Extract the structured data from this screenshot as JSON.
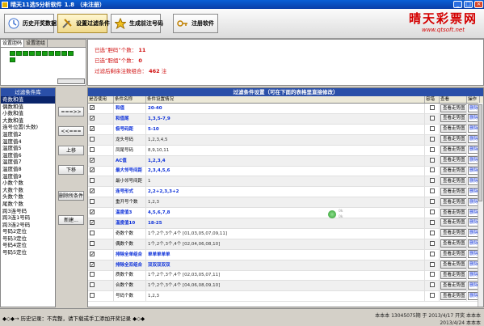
{
  "window": {
    "title": "晴天11选5分析软件",
    "version": "1.8",
    "reg_status": "（未注册）",
    "min": "_",
    "max": "□",
    "close": "×"
  },
  "toolbar": {
    "history_label": "历史开奖数据",
    "filter_label": "设置过滤条件",
    "generate_label": "生成前注号码",
    "register_label": "注册软件"
  },
  "brand": {
    "logo": "晴天彩票网",
    "url": "www.qtsoft.net"
  },
  "left_panel": {
    "tabs": [
      "设置胆码",
      "设置胆组"
    ]
  },
  "messages": {
    "line1_label": "已选“胆码”个数：",
    "line1_value": "11",
    "line2_label": "已选“胆组”个数：",
    "line2_value": "0",
    "line3_label": "过滤后剩余注数组合：",
    "line3_value": "462",
    "line3_unit": "注"
  },
  "condition_list": {
    "header": "过滤条件库",
    "items": [
      "奇数和值",
      "偶数和值",
      "小数和值",
      "大数和值",
      "连号位置(头数)",
      "温度值2",
      "温度值4",
      "温度值5",
      "温度值6",
      "温度值7",
      "温度值8",
      "温度值9",
      "小数个数",
      "大数个数",
      "头数个数",
      "尾数个数",
      "跨3连号码",
      "跨3连1号码",
      "跨3连2号码",
      "号码2定位",
      "号码3定位",
      "号码4定位",
      "号码5定位"
    ]
  },
  "middle_buttons": {
    "add_all": "===>>",
    "remove": "<<===",
    "move_up": "上移",
    "move_down": "下移",
    "delete_cond": "删除所条件",
    "new": "新建..."
  },
  "table": {
    "title": "过滤条件设置（可在下面的表格里直接修改）",
    "columns": [
      "是否使用",
      "条件名称",
      "条件设置情况",
      "容错",
      "查看",
      "操作"
    ],
    "chart_label": "查看走势图",
    "delete_label": "删除",
    "rows": [
      {
        "used": true,
        "name": "和值",
        "value": "20-40",
        "bold": true
      },
      {
        "used": true,
        "name": "和值尾",
        "value": "1,3,5-7,9",
        "bold": true
      },
      {
        "used": true,
        "name": "极号码距",
        "value": "5-10",
        "bold": true
      },
      {
        "used": false,
        "name": "龙头号码",
        "value": "1,2,3,4,5",
        "bold": false
      },
      {
        "used": false,
        "name": "凤尾号码",
        "value": "8,9,10,11",
        "bold": false
      },
      {
        "used": true,
        "name": "AC值",
        "value": "1,2,3,4",
        "bold": true
      },
      {
        "used": true,
        "name": "最大邻号间距",
        "value": "2,3,4,5,6",
        "bold": true
      },
      {
        "used": false,
        "name": "最小邻号间距",
        "value": "1",
        "bold": false
      },
      {
        "used": true,
        "name": "连号形式",
        "value": "2,2+2,3,3+2",
        "bold": true
      },
      {
        "used": false,
        "name": "重开号个数",
        "value": "1,2,3",
        "bold": false
      },
      {
        "used": true,
        "name": "温度值3",
        "value": "4,5,6,7,8",
        "bold": true
      },
      {
        "used": true,
        "name": "温度值10",
        "value": "18-25",
        "bold": true
      },
      {
        "used": false,
        "name": "奇数个数",
        "value": "1个,2个,3个,4个   [01,03,05,07,09,11]",
        "bold": false
      },
      {
        "used": false,
        "name": "偶数个数",
        "value": "1个,2个,3个,4个   [02,04,06,08,10]",
        "bold": false
      },
      {
        "used": true,
        "name": "排除全单组合",
        "value": "单单单单单",
        "bold": true
      },
      {
        "used": true,
        "name": "排除全双组合",
        "value": "双双双双双",
        "bold": true
      },
      {
        "used": false,
        "name": "质数个数",
        "value": "1个,2个,3个,4个   [02,03,05,07,11]",
        "bold": false
      },
      {
        "used": false,
        "name": "合数个数",
        "value": "1个,2个,3个,4个   [04,06,08,09,10]",
        "bold": false
      },
      {
        "used": false,
        "name": "号码个数",
        "value": "1,2,3",
        "bold": false
      }
    ]
  },
  "floating": {
    "line1": "0k",
    "line2": "0k"
  },
  "status": {
    "left": "◆◇◆→ 历史记录：不完整，请下载或手工添加开奖记录 ◆◇◆",
    "right_line1": "本本本   13045075期 于 2013/4/17 开奖   本本本",
    "right_line2": "2013/4/24 本本本"
  }
}
